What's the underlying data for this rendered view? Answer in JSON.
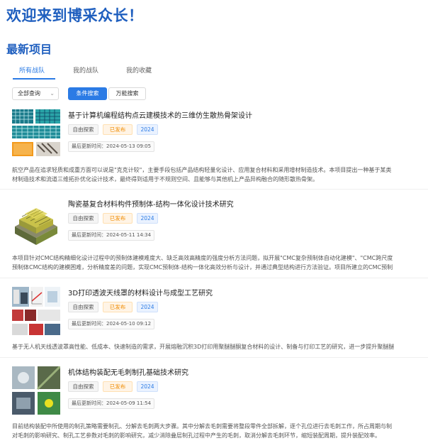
{
  "welcome": "欢迎来到博采众长！",
  "section_title": "最新项目",
  "tabs": [
    {
      "label": "所有战队",
      "active": true
    },
    {
      "label": "我的战队",
      "active": false
    },
    {
      "label": "我的收藏",
      "active": false
    }
  ],
  "filter": {
    "select_value": "全部查询",
    "search_button": "条件搜索",
    "universal_button": "万能搜索"
  },
  "projects": [
    {
      "title": "基于计算机编程结构点云建模技术的三维仿生散热骨架设计",
      "tag_type": "自由探索",
      "tag_status": "已发布",
      "tag_year": "2024",
      "updated": "最后更新时间：2024-05-13 09:05",
      "desc": "航空产品在追求轻质和成重方面可以说是\"克克计较\"，主要手段包括产品结构轻量化设计、应用复合材料和采用增材制造技术。本项目提出一种基于某类",
      "desc2": "材制造技术和流道三维拓扑优化设计技术，最终得到适用于不规则空间、且能够与其他机上产品异构融合的随形散热骨架。"
    },
    {
      "title": "陶瓷基复合材料构件预制体-结构一体化设计技术研究",
      "tag_type": "自由探索",
      "tag_status": "已发布",
      "tag_year": "2024",
      "updated": "最后更新时间：2024-05-11 14:34",
      "desc": "本项目针对CMC结构精细化设计过程中的预制体建模难度大、缺乏高效高精度的强度分析方法问题，拟开展\"CMC复杂预制体自动化建模\"、\"CMC跨尺度",
      "desc2": "预制体CMC结构的建模困难，分析精度差的问题，实现CMC预制体-结构一体化高效分析与设计，并通过典型结构进行方法验证。项目所建立的CMC预制"
    },
    {
      "title": "3D打印透波天线罩的材料设计与成型工艺研究",
      "tag_type": "自由探索",
      "tag_status": "已发布",
      "tag_year": "2024",
      "updated": "最后更新时间：2024-05-10 09:12",
      "desc": "基于无人机天线透波罩高性能、低成本、快速制造的需求，开展熔融沉积3D打印用聚醚醚酮复合材料的设计、制备与打印工艺的研究，进一步提升聚醚醚",
      "desc2": ""
    },
    {
      "title": "机体结构装配无毛刺制孔基础技术研究",
      "tag_type": "自由探索",
      "tag_status": "已发布",
      "tag_year": "2024",
      "updated": "最后更新时间：2024-05-09 11:54",
      "desc": "目前结构装配中所使用的制孔策略需要制孔、分解去毛刺两大步骤。其中分解去毛刺需要将整段零件全部拆解，逐个孔位进行去毛刺工作，所占周期与制",
      "desc2": "对毛刺的影响研究、制孔工艺参数对毛刺的影响研究，减少消除叠层制孔过程中产生的毛刺，取消分解去毛刺环节，缩短装配周期，提升装配效率。"
    }
  ],
  "colors": {
    "brand_blue": "#1f5fbf",
    "accent_blue": "#2b7be5",
    "status_orange": "#f08c00"
  }
}
